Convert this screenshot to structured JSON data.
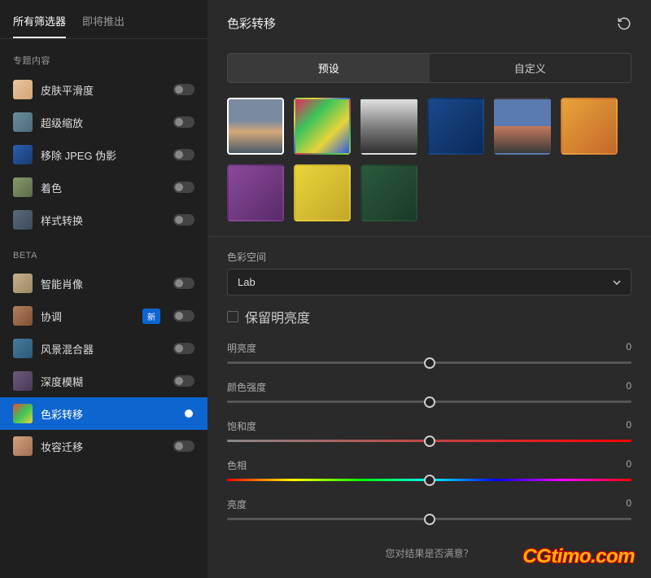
{
  "tabs": {
    "all": "所有筛选器",
    "upcoming": "即将推出"
  },
  "sections": {
    "featured": "专题内容",
    "beta": "BETA"
  },
  "filters": {
    "featured": [
      {
        "name": "皮肤平滑度",
        "on": false,
        "gradient": "linear-gradient(135deg,#e8c4a0,#d4a574)"
      },
      {
        "name": "超级缩放",
        "on": false,
        "gradient": "linear-gradient(135deg,#6b8e9e,#4a6b7a)"
      },
      {
        "name": "移除 JPEG 伪影",
        "on": false,
        "gradient": "linear-gradient(135deg,#2a5fb0,#1a3a70)"
      },
      {
        "name": "着色",
        "on": false,
        "gradient": "linear-gradient(135deg,#8a9a6a,#5a6a4a)"
      },
      {
        "name": "样式转换",
        "on": false,
        "gradient": "linear-gradient(135deg,#5a6a7a,#3a4a5a)"
      }
    ],
    "beta": [
      {
        "name": "智能肖像",
        "on": false,
        "gradient": "linear-gradient(135deg,#c4b090,#a08860)",
        "badge": null
      },
      {
        "name": "协调",
        "on": false,
        "gradient": "linear-gradient(135deg,#b08060,#805030)",
        "badge": "新"
      },
      {
        "name": "风景混合器",
        "on": false,
        "gradient": "linear-gradient(135deg,#4a7a9a,#2a5a7a)",
        "badge": null
      },
      {
        "name": "深度模糊",
        "on": false,
        "gradient": "linear-gradient(135deg,#6a5a7a,#4a3a5a)",
        "badge": null
      },
      {
        "name": "色彩转移",
        "on": true,
        "gradient": "linear-gradient(135deg,#e84a3a,#3ac45a,#e8d43a)",
        "badge": null
      },
      {
        "name": "妆容迁移",
        "on": false,
        "gradient": "linear-gradient(135deg,#d4a080,#a07050)",
        "badge": null
      }
    ]
  },
  "main": {
    "title": "色彩转移",
    "segmented": {
      "presets": "预设",
      "custom": "自定义"
    },
    "preset_gradients": [
      "linear-gradient(180deg,#7a8aa0 40%,#d4a878 60%,#4a5a6a)",
      "linear-gradient(135deg,#e82a5a,#3ac45a,#e8d43a,#2a5ae8)",
      "linear-gradient(180deg,#e0e0e0,#808080,#303030)",
      "linear-gradient(135deg,#1a4a8a,#0a2a5a)",
      "linear-gradient(180deg,#5a7ab0 50%,#c4785a 50%,#3a3a3a)",
      "linear-gradient(135deg,#e8a43a,#c4682a)",
      "linear-gradient(135deg,#8a4a9a,#5a2a6a)",
      "linear-gradient(135deg,#e8d43a,#c4a82a)",
      "linear-gradient(135deg,#2a5a3a,#1a3a2a)"
    ],
    "controls": {
      "colorspace_label": "色彩空间",
      "colorspace_value": "Lab",
      "preserve_luma": "保留明亮度",
      "sliders": [
        {
          "label": "明亮度",
          "value": "0",
          "pos": 50,
          "track": ""
        },
        {
          "label": "颜色强度",
          "value": "0",
          "pos": 50,
          "track": ""
        },
        {
          "label": "饱和度",
          "value": "0",
          "pos": 50,
          "track": "sat"
        },
        {
          "label": "色相",
          "value": "0",
          "pos": 50,
          "track": "hue"
        },
        {
          "label": "亮度",
          "value": "0",
          "pos": 50,
          "track": ""
        }
      ]
    },
    "feedback": "您对结果是否满意？"
  },
  "watermark": "CGtimo.com"
}
